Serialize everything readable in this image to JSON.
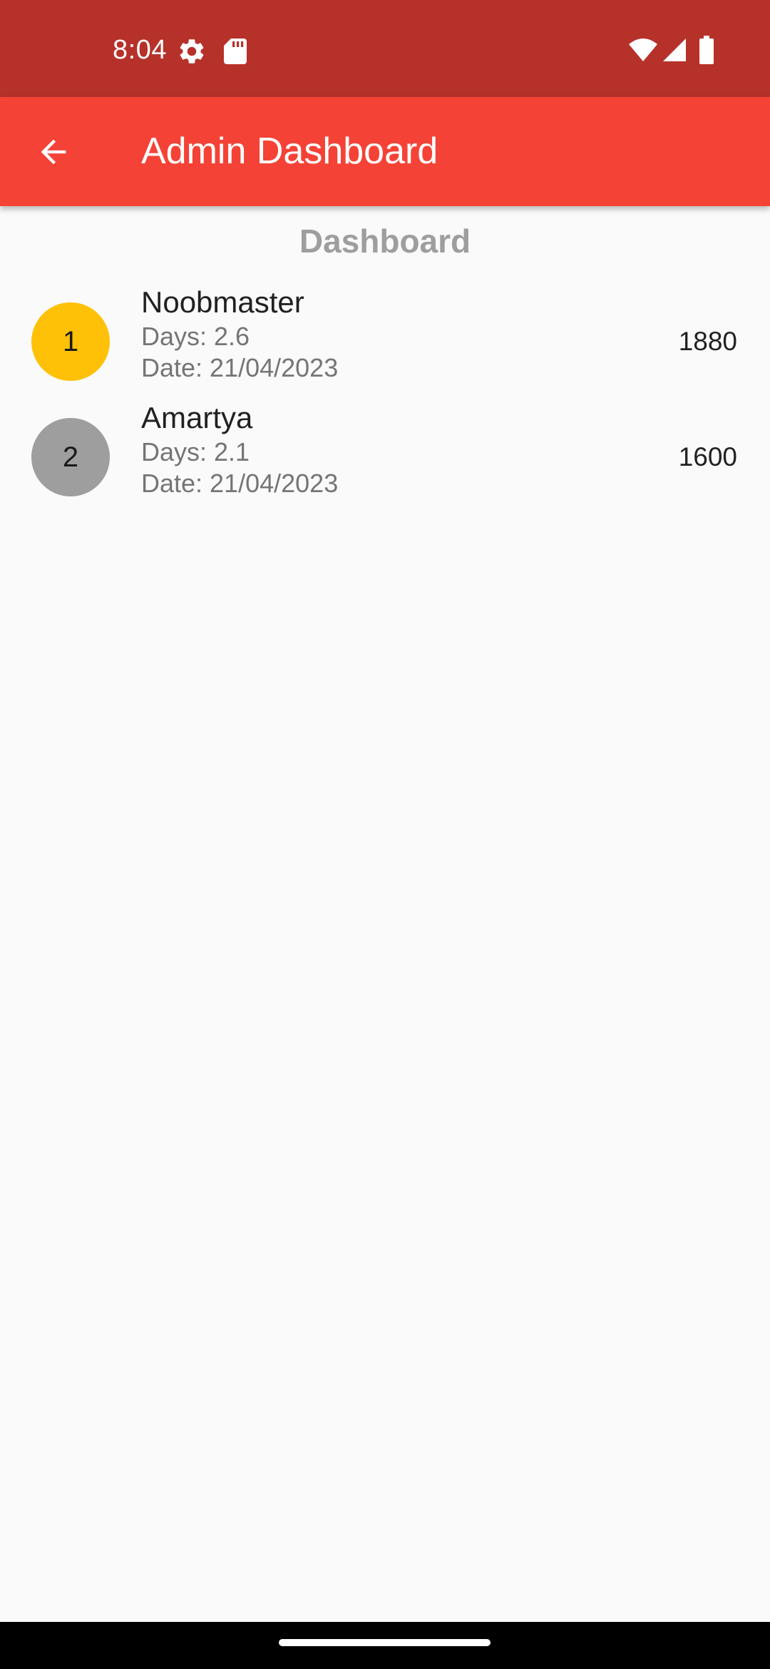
{
  "status_bar": {
    "time": "8:04",
    "icons": [
      "settings-gear-icon",
      "sd-card-icon",
      "wifi-icon",
      "signal-icon",
      "battery-icon"
    ]
  },
  "app_bar": {
    "title": "Admin Dashboard",
    "back_icon": "arrow-back-icon",
    "color": "#f44336",
    "status_color": "#b7312b"
  },
  "section_title": "Dashboard",
  "leaderboard": [
    {
      "rank": "1",
      "name": "Noobmaster",
      "days": "Days: 2.6",
      "date": "Date: 21/04/2023",
      "score": "1880",
      "color": "#ffc107"
    },
    {
      "rank": "2",
      "name": "Amartya",
      "days": "Days: 2.1",
      "date": "Date: 21/04/2023",
      "score": "1600",
      "color": "#9e9e9e"
    }
  ]
}
